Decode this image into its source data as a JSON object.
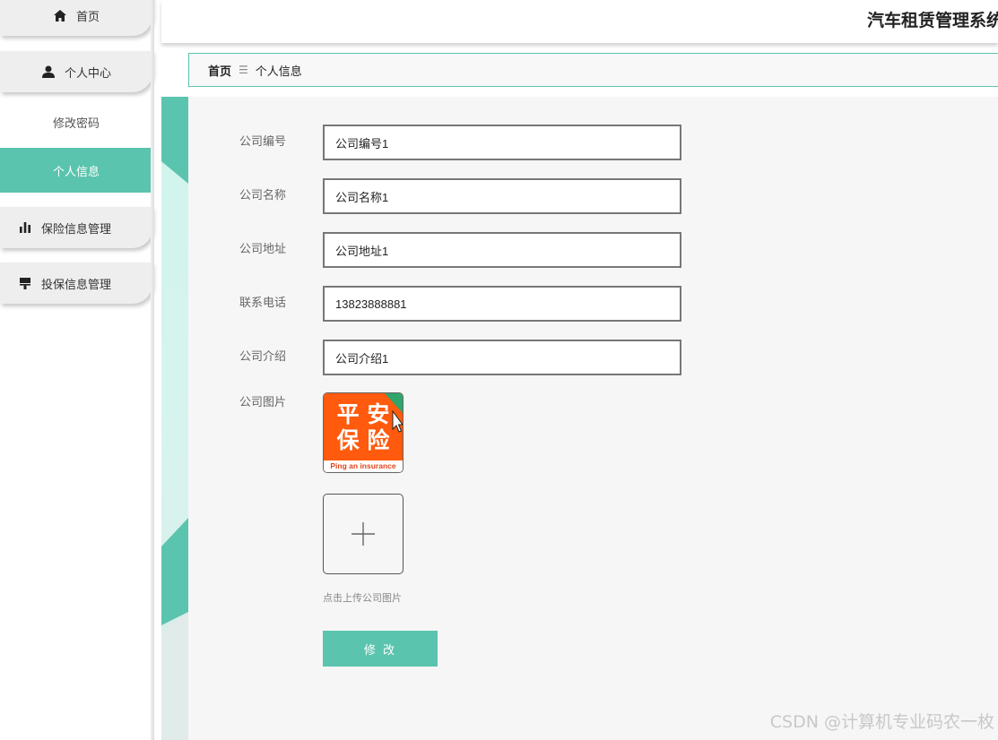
{
  "header": {
    "app_title": "汽车租赁管理系统"
  },
  "sidebar": {
    "items": [
      {
        "label": "首页",
        "icon": "home-icon"
      },
      {
        "label": "个人中心",
        "icon": "user-icon"
      },
      {
        "label": "保险信息管理",
        "icon": "bar-chart-icon"
      },
      {
        "label": "投保信息管理",
        "icon": "stamp-icon"
      }
    ],
    "submenu": [
      {
        "label": "修改密码"
      },
      {
        "label": "个人信息",
        "active": true
      }
    ]
  },
  "breadcrumb": {
    "home": "首页",
    "separator": "☰",
    "current": "个人信息"
  },
  "form": {
    "fields": [
      {
        "label": "公司编号",
        "value": "公司编号1"
      },
      {
        "label": "公司名称",
        "value": "公司名称1"
      },
      {
        "label": "公司地址",
        "value": "公司地址1"
      },
      {
        "label": "联系电话",
        "value": "13823888881"
      },
      {
        "label": "公司介绍",
        "value": "公司介绍1"
      }
    ],
    "image_label": "公司图片",
    "logo": {
      "line1": "平 安",
      "line2": "保 险",
      "caption": "Ping an insurance"
    },
    "upload_tip": "点击上传公司图片",
    "submit_label": "修 改"
  },
  "watermark": "CSDN @计算机专业码农一枚",
  "colors": {
    "accent": "#5bc4ae",
    "logo_orange": "#ff5a0d"
  }
}
